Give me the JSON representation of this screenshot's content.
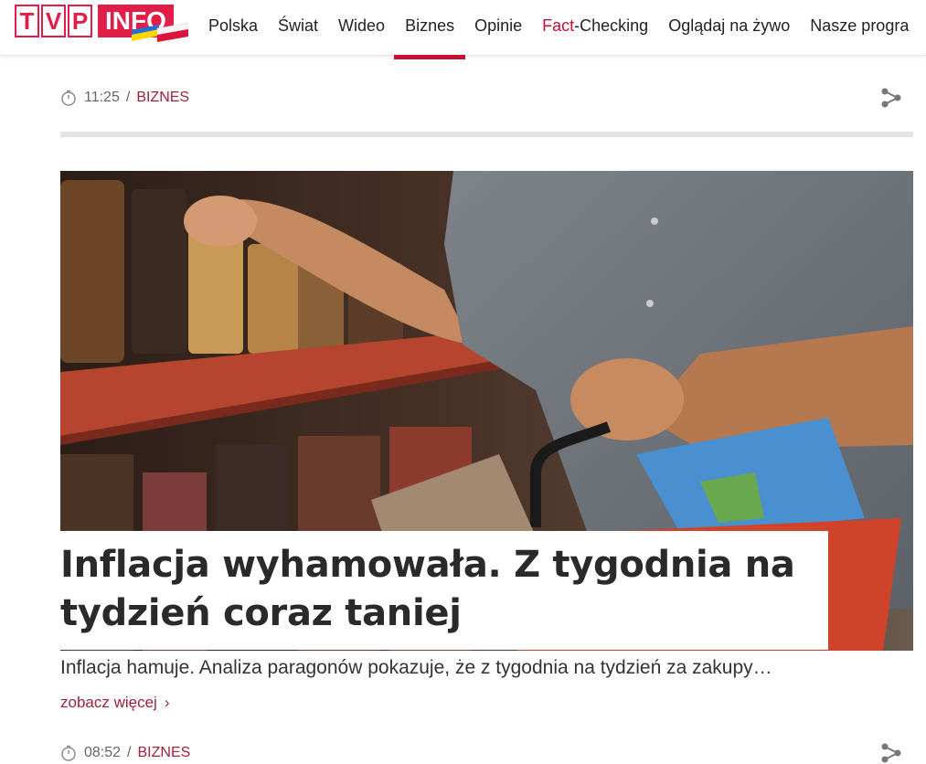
{
  "logo": {
    "letters": [
      "T",
      "V",
      "P"
    ],
    "brand": "INFO"
  },
  "nav": [
    {
      "label": "Polska"
    },
    {
      "label": "Świat"
    },
    {
      "label": "Wideo"
    },
    {
      "label": "Biznes",
      "active": true
    },
    {
      "label": "Opinie"
    },
    {
      "label_red": "Fact",
      "label_rest": "-Checking"
    },
    {
      "label": "Oglądaj na żywo"
    },
    {
      "label": "Nasze progra"
    }
  ],
  "article": {
    "time": "11:25",
    "separator": "/",
    "category": "BIZNES",
    "title": "Inflacja wyhamowała. Z tygodnia na tydzień coraz taniej",
    "lead": "Inflacja hamuje. Analiza paragonów pokazuje, że z tygodnia na tydzień za zakupy…",
    "more_label": "zobacz więcej",
    "more_icon": "chevron-right-icon"
  },
  "next_article": {
    "time": "08:52",
    "separator": "/",
    "category": "BIZNES"
  },
  "colors": {
    "brand_red": "#e11d48",
    "accent": "#c8102e",
    "category": "#a3213b",
    "divider": "#e3e3e3"
  },
  "icons": [
    "clock-icon",
    "share-icon",
    "chevron-right-icon"
  ]
}
